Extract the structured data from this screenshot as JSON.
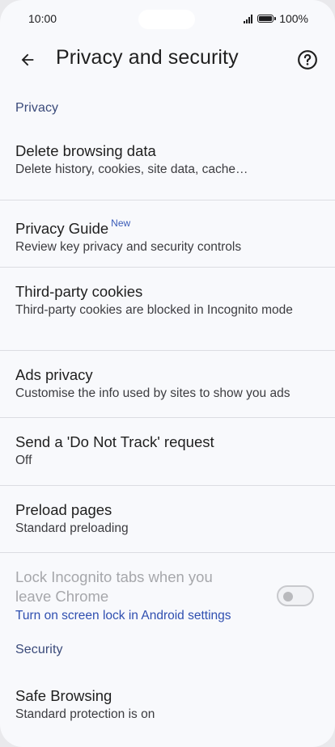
{
  "status_bar": {
    "time": "10:00",
    "battery": "100%"
  },
  "app_bar": {
    "title": "Privacy and security",
    "back_icon": "arrow-back-icon",
    "help_icon": "help-circle-icon"
  },
  "sections": {
    "privacy": "Privacy",
    "security": "Security"
  },
  "items": {
    "delete_browsing_data": {
      "title": "Delete browsing data",
      "subtitle": "Delete history, cookies, site data, cache…"
    },
    "privacy_guide": {
      "title": "Privacy Guide",
      "badge": "New",
      "subtitle": "Review key privacy and security controls"
    },
    "third_party_cookies": {
      "title": "Third-party cookies",
      "subtitle": "Third-party cookies are blocked in Incognito mode"
    },
    "ads_privacy": {
      "title": "Ads privacy",
      "subtitle": "Customise the info used by sites to show you ads"
    },
    "do_not_track": {
      "title": "Send a 'Do Not Track' request",
      "subtitle": "Off"
    },
    "preload_pages": {
      "title": "Preload pages",
      "subtitle": "Standard preloading"
    },
    "lock_incognito": {
      "title": "Lock Incognito tabs when you leave Chrome",
      "link": "Turn on screen lock in Android settings",
      "toggle_on": false,
      "enabled": false
    },
    "safe_browsing": {
      "title": "Safe Browsing",
      "subtitle": "Standard protection is on"
    }
  },
  "colors": {
    "background": "#f8f9fc",
    "section_header": "#3a4a7a",
    "link": "#2f4fb0",
    "divider": "#dcdde2",
    "disabled_text": "#a6a7ab"
  }
}
